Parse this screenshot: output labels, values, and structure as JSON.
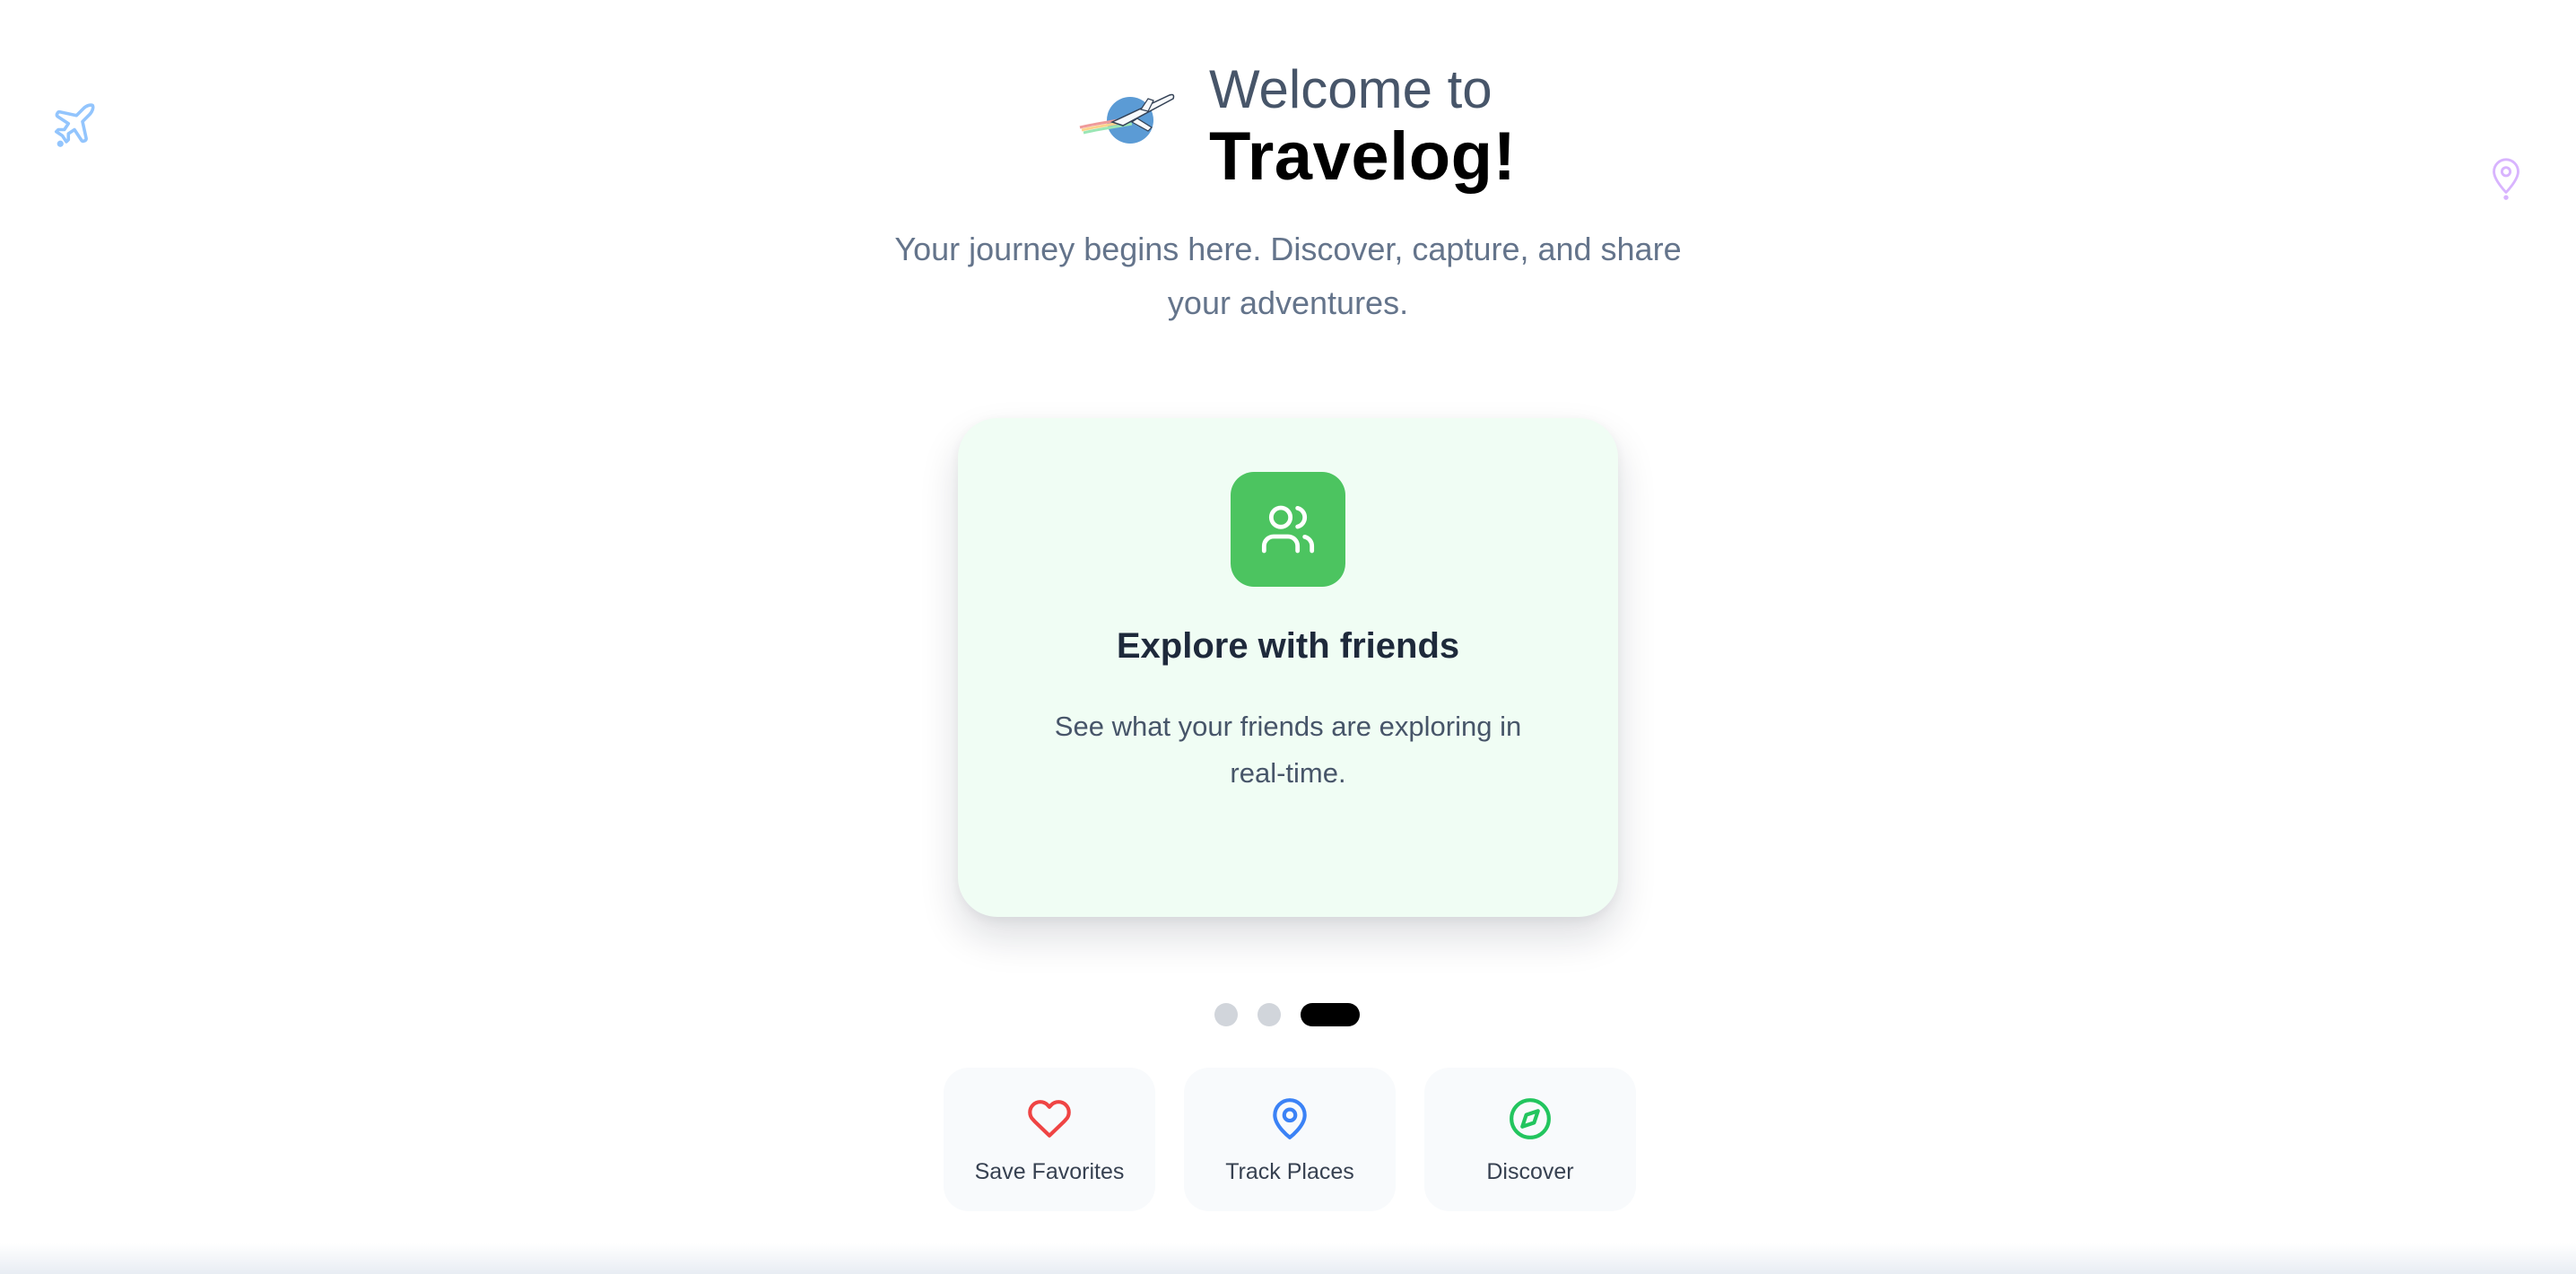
{
  "header": {
    "welcome": "Welcome to",
    "brand": "Travelog!",
    "tagline": "Your journey begins here. Discover, capture, and share your adventures."
  },
  "card": {
    "icon": "users-icon",
    "title": "Explore with friends",
    "description": "See what your friends are exploring in real-time.",
    "accent": "#4cc460",
    "background": "#f0fdf4"
  },
  "pager": {
    "count": 3,
    "active_index": 2
  },
  "features": [
    {
      "label": "Save Favorites",
      "icon": "heart-icon",
      "color": "#ef4444"
    },
    {
      "label": "Track Places",
      "icon": "map-pin-icon",
      "color": "#3b82f6"
    },
    {
      "label": "Discover",
      "icon": "compass-icon",
      "color": "#22c55e"
    }
  ],
  "decor": {
    "plane_icon_color": "#93c5fd",
    "pin_icon_color": "#d8b4fe"
  }
}
